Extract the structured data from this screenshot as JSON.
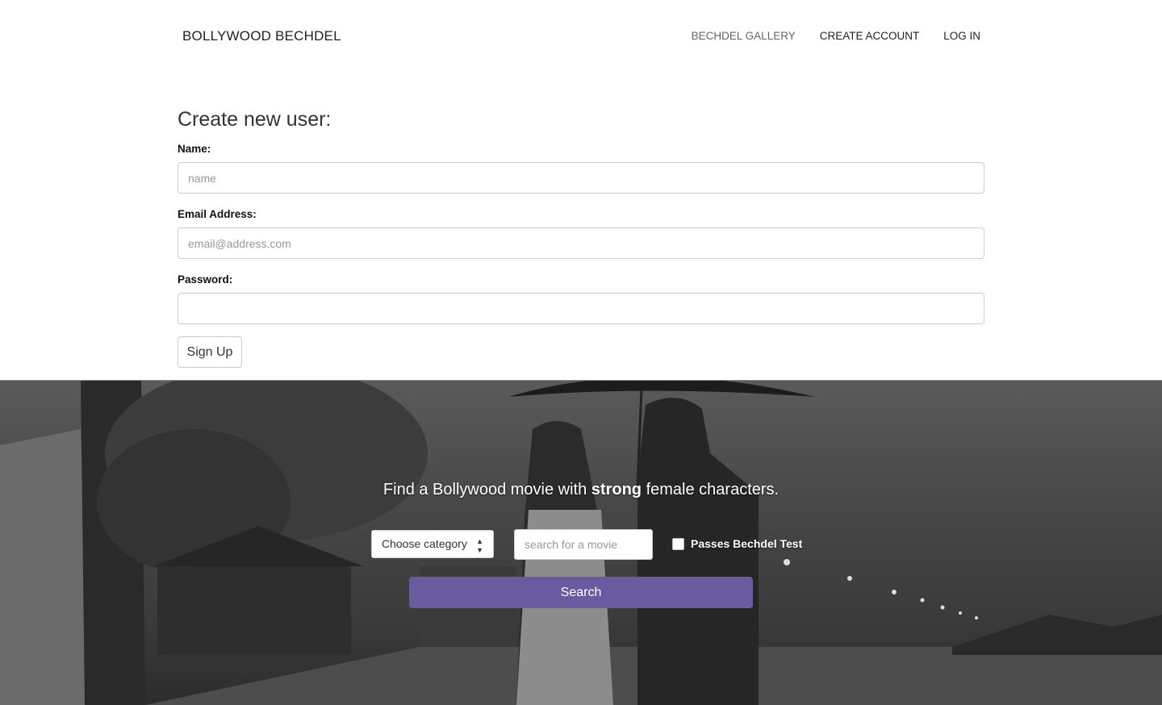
{
  "nav": {
    "brand": "BOLLYWOOD BECHDEL",
    "links": [
      "BECHDEL GALLERY",
      "CREATE ACCOUNT",
      "LOG IN"
    ]
  },
  "form": {
    "title": "Create new user:",
    "name_label": "Name:",
    "name_placeholder": "name",
    "email_label": "Email Address:",
    "email_placeholder": "email@address.com",
    "password_label": "Password:",
    "submit_label": "Sign Up"
  },
  "hero": {
    "tagline_pre": "Find a Bollywood movie with ",
    "tagline_bold": "strong",
    "tagline_post": " female characters.",
    "category_select": "Choose category",
    "search_placeholder": "search for a movie",
    "checkbox_label": "Passes Bechdel Test",
    "search_button": "Search"
  },
  "colors": {
    "accent": "#6a5aa0"
  }
}
